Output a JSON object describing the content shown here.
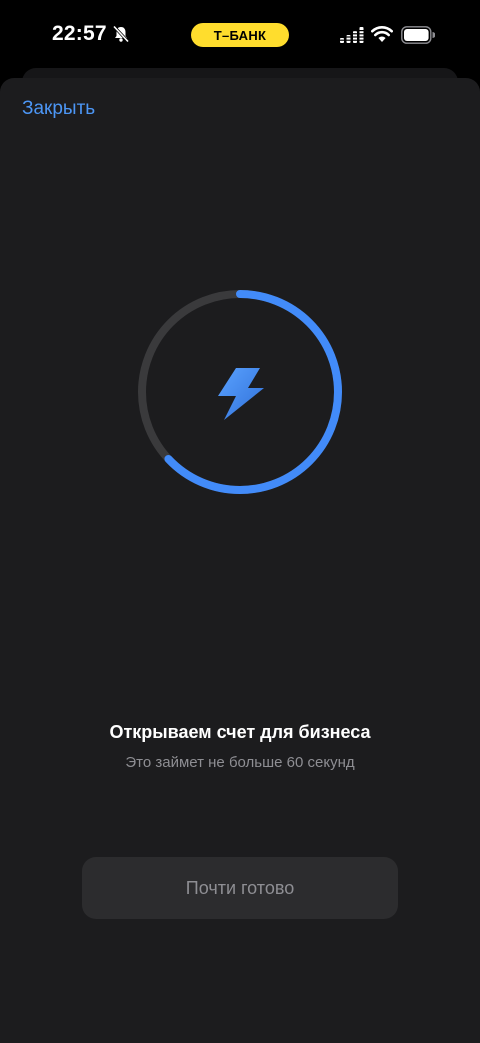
{
  "status_bar": {
    "time": "22:57",
    "carrier": "Т–БАНК",
    "icons": [
      "bell-off-icon",
      "signal-icon",
      "wifi-icon",
      "battery-icon"
    ]
  },
  "sheet": {
    "close_label": "Закрыть",
    "title": "Открываем счет для бизнеса",
    "subtitle": "Это займет не больше 60 секунд",
    "button_label": "Почти готово",
    "progress_fraction": 0.63
  },
  "colors": {
    "accent": "#428bf9",
    "carrier_pill": "#ffdd2d",
    "sheet_bg": "#1c1c1e",
    "ring_track": "#3a3a3c"
  }
}
